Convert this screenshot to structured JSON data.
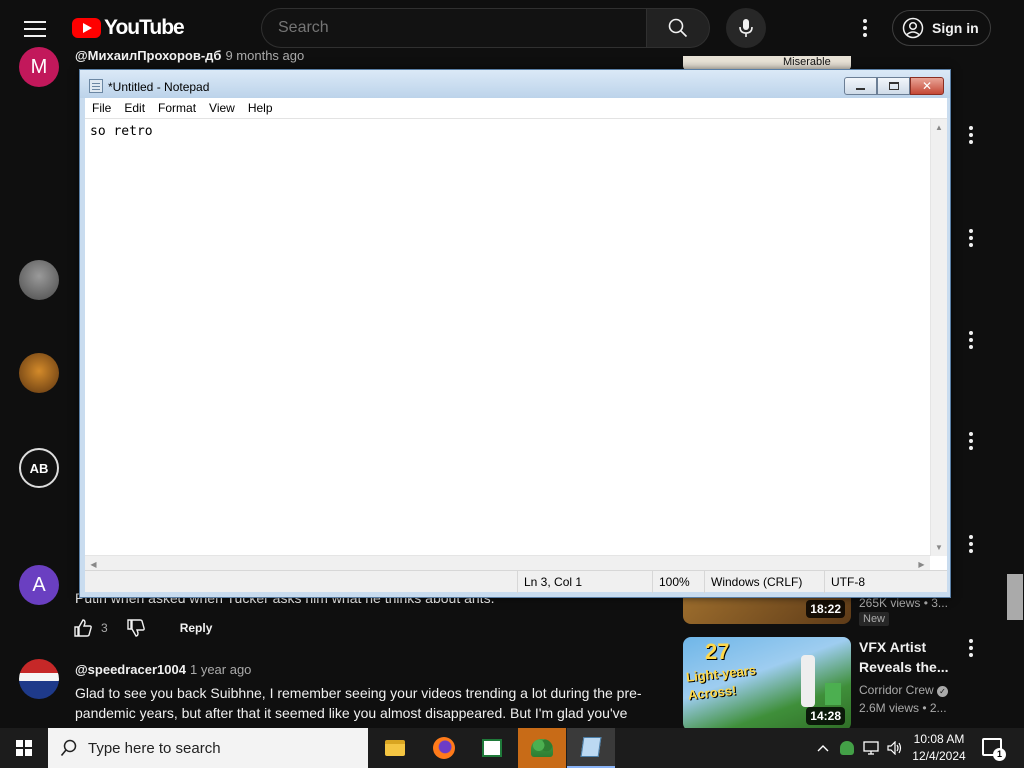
{
  "youtube": {
    "logo_text": "YouTube",
    "search_placeholder": "Search",
    "signin_label": "Sign in",
    "top_comment_author": "@МихаилПрохоров-дб",
    "top_comment_age": "9 months ago",
    "avatars": {
      "first": "M",
      "fourth": "AB",
      "fifth": "A"
    },
    "comment_snippet": "Putin when asked when Tucker asks him what he thinks about ants.",
    "like_count": "3",
    "reply_label": "Reply",
    "comment2": {
      "author": "@speedracer1004",
      "age": "1 year ago",
      "text": "Glad to see you back Suibhne, I remember seeing your videos trending a lot during the pre-pandemic years, but after that it seemed like you almost disappeared. But I'm glad you've"
    },
    "sidebar": {
      "top_thumb_text": "Miserable",
      "video1": {
        "duration": "18:22",
        "views": "265K views • 3...",
        "badge": "New"
      },
      "video2": {
        "title_line1": "VFX Artist",
        "title_line2": "Reveals the...",
        "channel": "Corridor Crew",
        "views": "2.6M views • 2...",
        "duration": "14:28",
        "thumb_big": "27",
        "thumb_sub1": "Light-years",
        "thumb_sub2": "Across!"
      }
    }
  },
  "notepad": {
    "title": "*Untitled - Notepad",
    "menu": [
      "File",
      "Edit",
      "Format",
      "View",
      "Help"
    ],
    "content": "so retro",
    "status": {
      "position": "Ln 3, Col 1",
      "zoom": "100%",
      "line_ending": "Windows (CRLF)",
      "encoding": "UTF-8"
    }
  },
  "taskbar": {
    "search_placeholder": "Type here to search",
    "time": "10:08 AM",
    "date": "12/4/2024",
    "notification_count": "1"
  }
}
